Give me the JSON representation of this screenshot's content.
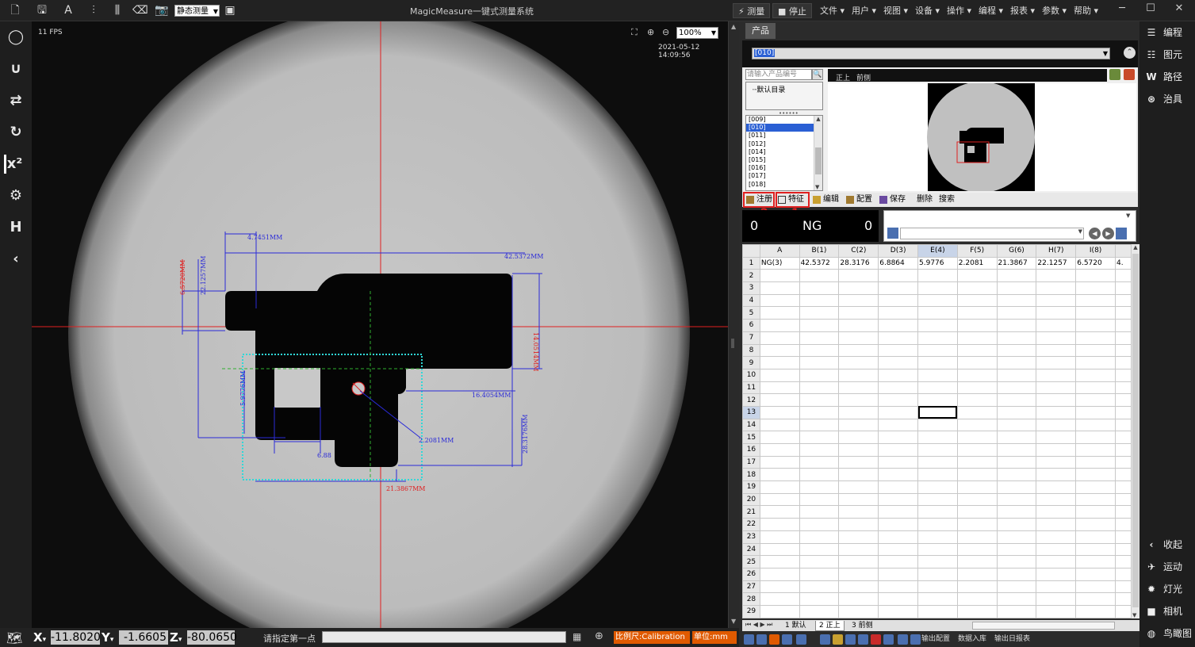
{
  "app": {
    "title": "MagicMeasure一键式测量系统"
  },
  "toolbar": {
    "mode_select": "静态测量",
    "run_measure": "测量",
    "run_stop": "停止"
  },
  "menu": [
    "文件",
    "用户",
    "视图",
    "设备",
    "操作",
    "编程",
    "报表",
    "参数",
    "帮助"
  ],
  "camera": {
    "fps": "11 FPS",
    "zoom": "100%",
    "timestamp": "2021-05-12 14:09:56",
    "annotations": [
      {
        "text": "4.7451MM",
        "color": "#2a2ad8"
      },
      {
        "text": "42.5372MM",
        "color": "#2a2ad8"
      },
      {
        "text": "6.5720MM",
        "color": "#e02020"
      },
      {
        "text": "22.1257MM",
        "color": "#2a2ad8"
      },
      {
        "text": "14.0514MM",
        "color": "#e02020"
      },
      {
        "text": "16.4054MM",
        "color": "#2a2ad8"
      },
      {
        "text": "5.9776MM",
        "color": "#2a2ad8"
      },
      {
        "text": "2.2081MM",
        "color": "#2a2ad8"
      },
      {
        "text": "6.88",
        "color": "#2a2ad8"
      },
      {
        "text": "28.3176MM",
        "color": "#2a2ad8"
      },
      {
        "text": "21.3867MM",
        "color": "#e02020"
      }
    ]
  },
  "status": {
    "x_label": "X",
    "x_value": "-11.8020",
    "y_label": "Y",
    "y_value": "-1.6605",
    "z_label": "Z",
    "z_value": "-80.0650",
    "prompt": "请指定第一点",
    "scale": "比例尺:Calibration",
    "unit": "单位:mm"
  },
  "product": {
    "tab": "产品",
    "combo_value": "[010]",
    "search_placeholder": "请输入产品编号",
    "default_dir": "默认目录",
    "list": [
      "[009]",
      "[010]",
      "[011]",
      "[012]",
      "[014]",
      "[015]",
      "[016]",
      "[017]",
      "[018]"
    ],
    "selected_index": 1,
    "preview_tabs": [
      "正上",
      "前侧"
    ]
  },
  "actions": {
    "register": "注册",
    "feature": "特征",
    "edit": "编辑",
    "config": "配置",
    "save": "保存",
    "delete": "删除",
    "search": "搜索",
    "marker_feature": "1",
    "marker_register": "2"
  },
  "counts": {
    "ok": "0",
    "label": "NG",
    "ng": "0"
  },
  "sheet": {
    "columns": [
      "A",
      "B(1)",
      "C(2)",
      "D(3)",
      "E(4)",
      "F(5)",
      "G(6)",
      "H(7)",
      "I(8)",
      ""
    ],
    "row1": [
      "NG(3)",
      "42.5372",
      "28.3176",
      "6.8864",
      "5.9776",
      "2.2081",
      "21.3867",
      "22.1257",
      "6.5720",
      "4."
    ],
    "row1_ng_cols": [
      0,
      6,
      8
    ],
    "selected_row": 13,
    "selected_col": 4,
    "row_count": 29,
    "tabs": [
      "1 默认",
      "2 正上",
      "3 前侧"
    ],
    "active_tab": 1
  },
  "bottom_tools": {
    "export_config": "输出配置",
    "data_import": "数据入库",
    "export_daily": "输出日报表"
  },
  "rightnav": {
    "program": "编程",
    "element": "图元",
    "path": "路径",
    "fixture": "治具",
    "collapse": "收起",
    "motion": "运动",
    "light": "灯光",
    "camera": "相机",
    "birdseye": "鸟瞰图"
  },
  "colors": {
    "accent_orange": "#e05a00",
    "ng_red": "#e02020",
    "measure_blue": "#2a2ad8",
    "roi_cyan": "#30d8d8",
    "crosshair_red": "#e02020",
    "select_blue": "#2a5fd4"
  }
}
